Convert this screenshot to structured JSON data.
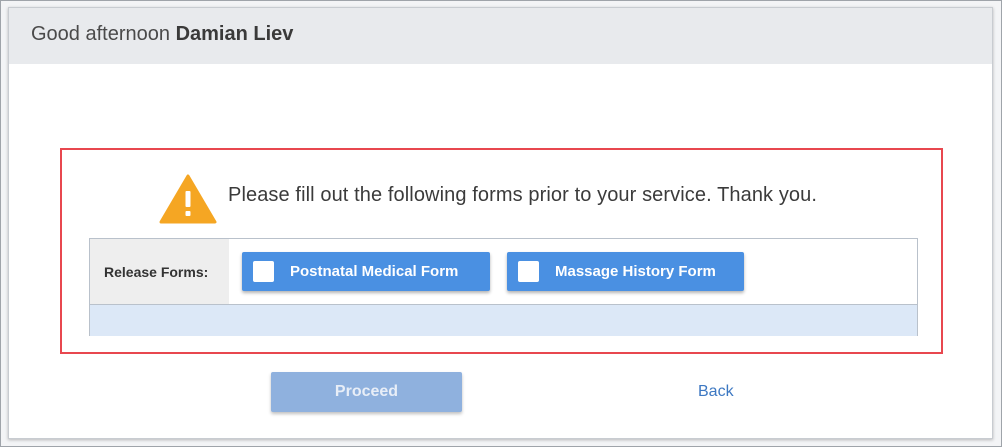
{
  "header": {
    "greeting_prefix": "Good afternoon",
    "user_name": "Damian Liev"
  },
  "alert": {
    "icon": "warning-icon",
    "message": "Please fill out the following forms prior to your service. Thank you.",
    "border_color": "#e8474f"
  },
  "forms": {
    "label": "Release Forms:",
    "items": [
      {
        "label": "Postnatal Medical Form",
        "checked": false
      },
      {
        "label": "Massage History Form",
        "checked": false
      }
    ],
    "button_color": "#4a90e2"
  },
  "actions": {
    "proceed_label": "Proceed",
    "proceed_disabled": true,
    "back_label": "Back"
  },
  "colors": {
    "warning": "#f5a623",
    "link": "#3d78c2",
    "proceed_disabled": "#8fb1de"
  }
}
